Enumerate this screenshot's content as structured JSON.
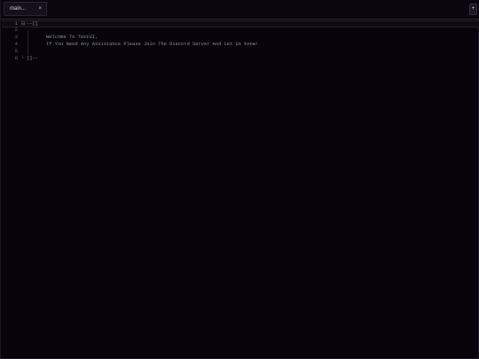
{
  "tabs": [
    {
      "title": "main...",
      "close": "×"
    }
  ],
  "add_tab": "+",
  "editor": {
    "fold_open": "⊟",
    "fold_close": "└",
    "lines": [
      {
        "num": "1",
        "text": "--[["
      },
      {
        "num": "2",
        "text": ""
      },
      {
        "num": "3",
        "text": "Welcome To TestUI,"
      },
      {
        "num": "4",
        "text": "If You Need Any Assistance Please Join The Discord Server And Let Us Know!"
      },
      {
        "num": "5",
        "text": ""
      },
      {
        "num": "6",
        "text": "]]--"
      }
    ]
  }
}
